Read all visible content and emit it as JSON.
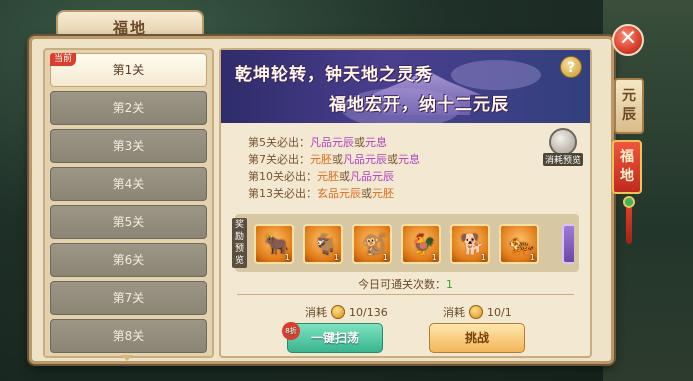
{
  "window": {
    "title": "福地"
  },
  "stages": {
    "current_badge": "当前",
    "items": [
      {
        "label": "第1关"
      },
      {
        "label": "第2关"
      },
      {
        "label": "第3关"
      },
      {
        "label": "第4关"
      },
      {
        "label": "第5关"
      },
      {
        "label": "第6关"
      },
      {
        "label": "第7关"
      },
      {
        "label": "第8关"
      }
    ]
  },
  "banner": {
    "line1": "乾坤轮转，钟天地之灵秀",
    "line2": "福地宏开，纳十二元辰",
    "help": "?"
  },
  "drops": [
    {
      "prefix": "第5关必出：",
      "a": "凡品元辰",
      "sep": "或",
      "b": "元息",
      "c": ""
    },
    {
      "prefix": "第7关必出：",
      "a": "元胚",
      "sep": "或",
      "b": "凡品元辰",
      "sep2": "或",
      "c": "元息"
    },
    {
      "prefix": "第10关必出：",
      "a": "元胚",
      "sep": "或",
      "b": "凡品元辰",
      "c": ""
    },
    {
      "prefix": "第13关必出：",
      "a": "玄品元辰",
      "sep": "或",
      "b": "元胚",
      "c": ""
    }
  ],
  "consume_preview": {
    "label": "消耗预览"
  },
  "rewards": {
    "label": "奖励预览",
    "items": [
      {
        "icon": "ox-icon",
        "glyph": "🐂",
        "count": "1"
      },
      {
        "icon": "goat-icon",
        "glyph": "🐐",
        "count": "1"
      },
      {
        "icon": "monkey-icon",
        "glyph": "🐒",
        "count": "1"
      },
      {
        "icon": "rooster-icon",
        "glyph": "🐓",
        "count": "1"
      },
      {
        "icon": "dog-icon",
        "glyph": "🐕",
        "count": "1"
      },
      {
        "icon": "tiger-icon",
        "glyph": "🐅",
        "count": "1"
      }
    ]
  },
  "today": {
    "label": "今日可通关次数：",
    "value": "1"
  },
  "sweep": {
    "cost_label": "消耗",
    "cost_value": "10/136",
    "button": "一键扫荡",
    "discount": "8折"
  },
  "challenge": {
    "cost_label": "消耗",
    "cost_value": "10/1",
    "button": "挑战"
  },
  "side_tabs": {
    "yuanchen": "元辰",
    "fudi": "福地"
  },
  "close": "✕",
  "colors": {
    "accent_orange": "#e06b17",
    "accent_purple": "#b13fbf",
    "count_green": "#3f9c2e"
  }
}
